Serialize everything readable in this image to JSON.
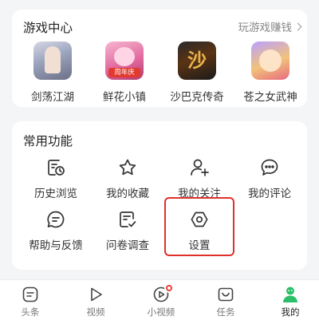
{
  "games": {
    "title": "游戏中心",
    "more_label": "玩游戏赚钱",
    "items": [
      {
        "label": "剑荡江湖",
        "icon": "game-jiandang-icon"
      },
      {
        "label": "鲜花小镇",
        "icon": "game-xianhua-icon",
        "badge": "周年庆"
      },
      {
        "label": "沙巴克传奇",
        "icon": "game-shabake-icon",
        "logo_text": "沙"
      },
      {
        "label": "苍之女武神",
        "icon": "game-cangzhi-icon"
      }
    ]
  },
  "functions": {
    "title": "常用功能",
    "items": [
      {
        "label": "历史浏览",
        "icon": "history-icon"
      },
      {
        "label": "我的收藏",
        "icon": "star-icon"
      },
      {
        "label": "我的关注",
        "icon": "add-user-icon"
      },
      {
        "label": "我的评论",
        "icon": "comment-icon"
      },
      {
        "label": "帮助与反馈",
        "icon": "help-feedback-icon"
      },
      {
        "label": "问卷调查",
        "icon": "survey-icon"
      },
      {
        "label": "设置",
        "icon": "settings-icon"
      }
    ]
  },
  "tabbar": {
    "items": [
      {
        "label": "头条",
        "icon": "headline-icon",
        "active": false
      },
      {
        "label": "视频",
        "icon": "video-play-icon",
        "active": false
      },
      {
        "label": "小视频",
        "icon": "short-video-icon",
        "active": false,
        "has_dot": true
      },
      {
        "label": "任务",
        "icon": "task-icon",
        "active": false
      },
      {
        "label": "我的",
        "icon": "profile-icon",
        "active": true
      }
    ]
  },
  "colors": {
    "accent_green": "#2bbf6a",
    "highlight_red": "#e0302b",
    "notification_red": "#e8423a",
    "background": "#f4f5f6"
  }
}
